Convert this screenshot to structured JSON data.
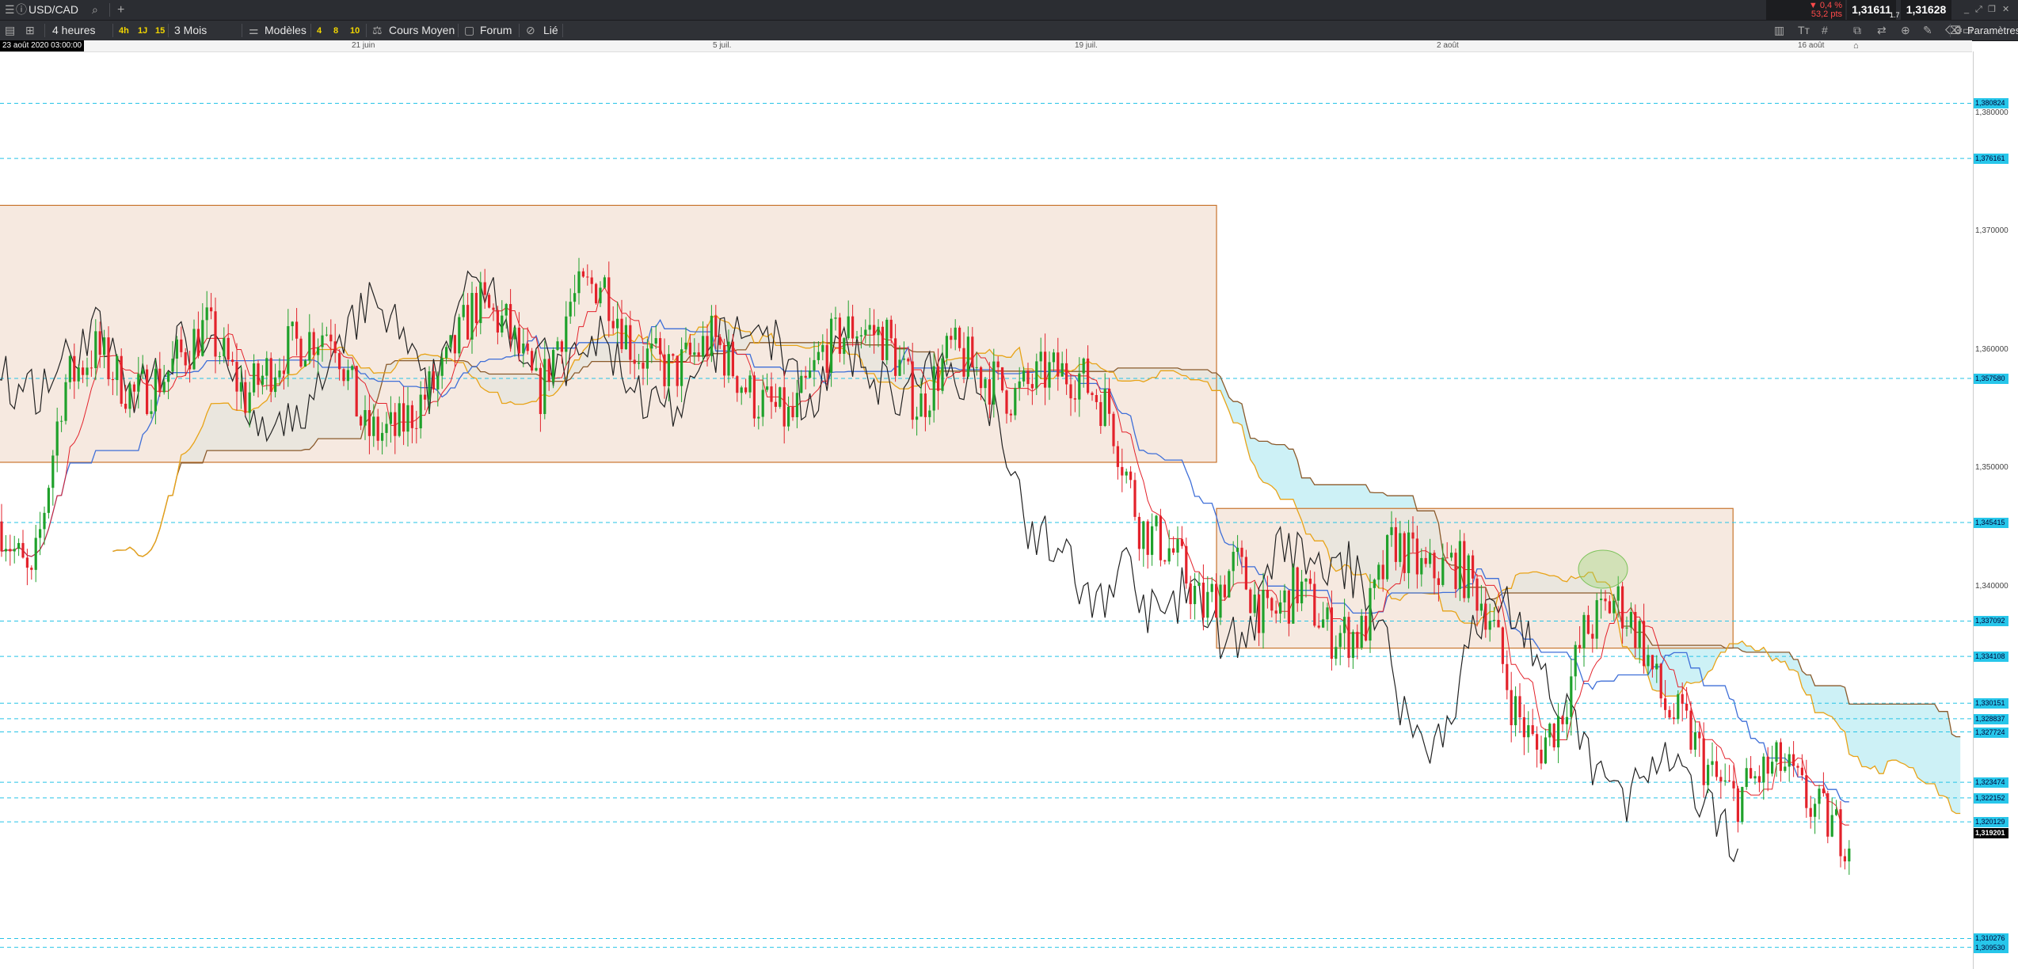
{
  "toolbar": {
    "symbol": "USD/CAD",
    "timeframe": "4 heures",
    "period_buttons": [
      "4h",
      "1J",
      "15"
    ],
    "range": "3 Mois",
    "templates": "Modèles",
    "ma_buttons": [
      "4",
      "8",
      "10"
    ],
    "average_cost": "Cours Moyen",
    "forum": "Forum",
    "linked": "Lié",
    "settings": "Paramètres",
    "change_pct": "▼ 0,4 %",
    "change_pts": "53,2 pts",
    "bid": "1,31611",
    "spread": "1.7",
    "ask": "1,31628"
  },
  "date_axis": {
    "cursor_date": "23 août 2020 03:00:00",
    "labels": [
      "21 juin",
      "5 juil.",
      "19 juil.",
      "2 août",
      "16 août"
    ]
  },
  "chart_data": {
    "type": "candlestick",
    "ylim": [
      1.3077,
      1.3852
    ],
    "y_ticks": [
      "1,380000",
      "1,370000",
      "1,360000",
      "1,350000",
      "1,340000"
    ],
    "levels": [
      "1,380824",
      "1,376161",
      "1,357580",
      "1,345415",
      "1,337092",
      "1,334108",
      "1,330151",
      "1,328837",
      "1,327724",
      "1,323474",
      "1,322152",
      "1,320129",
      "1,310276",
      "1,309530"
    ],
    "last_price": "1,319201",
    "zones": [
      {
        "start": "2020-06-04",
        "end": "2020-07-24",
        "low": 1.3505,
        "high": 1.3722
      },
      {
        "start": "2020-07-24",
        "end": "2020-08-13",
        "low": 1.3348,
        "high": 1.3466
      }
    ],
    "colors": {
      "up": "#1fa12b",
      "down": "#e3222b",
      "kijun": "#3f6fd8",
      "tenkan": "#e3222b",
      "chikou": "#222222",
      "senkou_b": "#8a5a2b",
      "senkou_a": "#e8a317",
      "cloud": "#c8f0f5",
      "zone": "#f3e1d6"
    }
  }
}
